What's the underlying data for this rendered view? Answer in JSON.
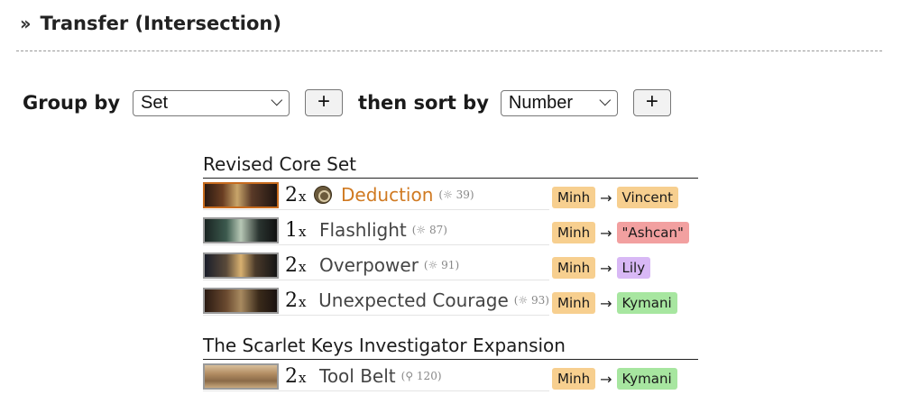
{
  "header": {
    "title": "Transfer (Intersection)",
    "icon": "double-chevron-right-icon"
  },
  "controls": {
    "group_label": "Group by",
    "group_value": "Set",
    "sort_label": "then sort by",
    "sort_value": "Number",
    "add_label": "+"
  },
  "colors": {
    "minh": "#f7cf8f",
    "vincent": "#f7cf8f",
    "ashcan": "#f2a0a0",
    "lily": "#d8b8f5",
    "kymani": "#a7e6a0",
    "seeker_name": "#d07a22"
  },
  "groups": [
    {
      "title": "Revised Core Set",
      "cards": [
        {
          "qty": "2",
          "x": "x",
          "name": "Deduction",
          "number": "(☼ 39)",
          "from": "Minh",
          "to": "Vincent",
          "to_color": "#f7cf8f",
          "faction": "seeker",
          "thumb": "art-deduction"
        },
        {
          "qty": "1",
          "x": "x",
          "name": "Flashlight",
          "number": "(☼ 87)",
          "from": "Minh",
          "to": "\"Ashcan\"",
          "to_color": "#f2a0a0",
          "faction": "neutral",
          "thumb": "art-flashlight"
        },
        {
          "qty": "2",
          "x": "x",
          "name": "Overpower",
          "number": "(☼ 91)",
          "from": "Minh",
          "to": "Lily",
          "to_color": "#d8b8f5",
          "faction": "neutral",
          "thumb": "art-overpower"
        },
        {
          "qty": "2",
          "x": "x",
          "name": "Unexpected Courage",
          "number": "(☼ 93)",
          "from": "Minh",
          "to": "Kymani",
          "to_color": "#a7e6a0",
          "faction": "neutral",
          "thumb": "art-courage"
        }
      ]
    },
    {
      "title": "The Scarlet Keys Investigator Expansion",
      "cards": [
        {
          "qty": "2",
          "x": "x",
          "name": "Tool Belt",
          "number": "(⚲ 120)",
          "from": "Minh",
          "to": "Kymani",
          "to_color": "#a7e6a0",
          "faction": "neutral",
          "thumb": "art-toolbelt"
        }
      ]
    }
  ]
}
